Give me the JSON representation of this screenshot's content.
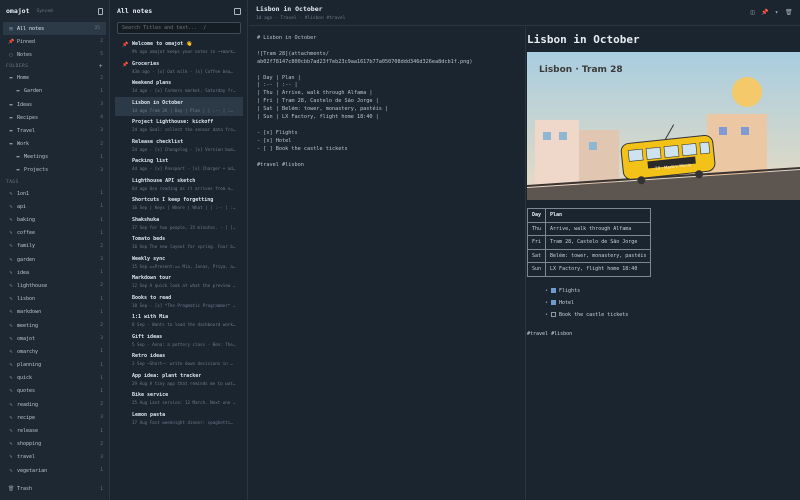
{
  "app": {
    "name": "omajot",
    "sync_status": "Synced"
  },
  "sidebar": {
    "top": [
      {
        "label": "All notes",
        "count": "25",
        "icon": "notes-icon"
      },
      {
        "label": "Pinned",
        "count": "2",
        "icon": "pin-icon"
      },
      {
        "label": "Notes",
        "count": "5",
        "icon": "document-icon"
      }
    ],
    "folders_label": "FOLDERS",
    "folders": [
      {
        "label": "Home",
        "count": "2"
      },
      {
        "label": "Garden",
        "count": "1",
        "indent": true
      },
      {
        "label": "Ideas",
        "count": "3"
      },
      {
        "label": "Recipes",
        "count": "4"
      },
      {
        "label": "Travel",
        "count": "3"
      },
      {
        "label": "Work",
        "count": "2"
      },
      {
        "label": "Meetings",
        "count": "1",
        "indent": true
      },
      {
        "label": "Projects",
        "count": "3",
        "indent": true
      }
    ],
    "tags_label": "TAGS",
    "tags": [
      {
        "label": "1on1",
        "count": "1"
      },
      {
        "label": "api",
        "count": "1"
      },
      {
        "label": "baking",
        "count": "1"
      },
      {
        "label": "coffee",
        "count": "1"
      },
      {
        "label": "family",
        "count": "2"
      },
      {
        "label": "garden",
        "count": "3"
      },
      {
        "label": "idea",
        "count": "1"
      },
      {
        "label": "lighthouse",
        "count": "2"
      },
      {
        "label": "lisbon",
        "count": "1"
      },
      {
        "label": "markdown",
        "count": "1"
      },
      {
        "label": "meeting",
        "count": "2"
      },
      {
        "label": "omajot",
        "count": "3"
      },
      {
        "label": "omarchy",
        "count": "1"
      },
      {
        "label": "planning",
        "count": "1"
      },
      {
        "label": "quick",
        "count": "1"
      },
      {
        "label": "quotes",
        "count": "1"
      },
      {
        "label": "reading",
        "count": "2"
      },
      {
        "label": "recipe",
        "count": "3"
      },
      {
        "label": "release",
        "count": "1"
      },
      {
        "label": "shopping",
        "count": "2"
      },
      {
        "label": "travel",
        "count": "3"
      },
      {
        "label": "vegetarian",
        "count": "1"
      }
    ],
    "trash": {
      "label": "Trash",
      "count": "1"
    }
  },
  "notelist": {
    "title": "All notes",
    "search_placeholder": "Search Titles and text...  /",
    "notes": [
      {
        "title": "Welcome to omajot 👋",
        "preview": "9h ago  omajot keeps your notes in ~+mark…",
        "pinned": true
      },
      {
        "title": "Groceries",
        "preview": "43m ago  - [x] Oat milk - [x] Coffee bea…",
        "pinned": true
      },
      {
        "title": "Weekend plans",
        "preview": "1d ago  - [x] Farmers market, Saturday fr…"
      },
      {
        "title": "Lisbon in October",
        "preview": "1d ago  Tram 28 | Day | Plan | | :-- | :…",
        "active": true
      },
      {
        "title": "Project Lighthouse: kickoff",
        "preview": "2d ago  Goal: collect the sensor data fro…"
      },
      {
        "title": "Release checklist",
        "preview": "2d ago  - [x] Changelog - [x] Version bum…"
      },
      {
        "title": "Packing list",
        "preview": "4d ago  - [x] Passport - [x] Charger + ad…"
      },
      {
        "title": "Lighthouse API sketch",
        "preview": "6d ago  Use reading as it arrives from e…"
      },
      {
        "title": "Shortcuts I keep forgetting",
        "preview": "16 Sep  | Keys | Where | What | | :-- | :…"
      },
      {
        "title": "Shakshuka",
        "preview": "17 Sep  for two people, 25 minutes. - [ ]…"
      },
      {
        "title": "Tomato beds",
        "preview": "16 Sep  The new layout for spring. Four b…"
      },
      {
        "title": "Weekly sync",
        "preview": "15 Sep  ==Present:== Mia, Jonas, Priya, a…"
      },
      {
        "title": "Markdown tour",
        "preview": "12 Sep  A quick look at what the preview …"
      },
      {
        "title": "Books to read",
        "preview": "10 Sep  - [x] *The Pragmatic Programmer* …"
      },
      {
        "title": "1:1 with Mia",
        "preview": "8 Sep  - Wants to lead the dashboard work…"
      },
      {
        "title": "Gift ideas",
        "preview": "5 Sep  - Anna: a pottery class - Ben: The…"
      },
      {
        "title": "Retro ideas",
        "preview": "3 Sep  ~Short~: write down decisions in …"
      },
      {
        "title": "App idea: plant tracker",
        "preview": "29 Aug  A tiny app that reminds me to wat…"
      },
      {
        "title": "Bike service",
        "preview": "25 Aug  Last service: 12 March. Next one …"
      },
      {
        "title": "Lemon pasta",
        "preview": "17 Aug  Fast weeknight dinner: spaghetti…"
      }
    ]
  },
  "note": {
    "title": "Lisbon in October",
    "meta": "1d ago  ·  Travel  ·  #lisbon #travel",
    "source": "# Lisbon in October\n\n![Tram 28](attachments/\nab02f78147c800cbb7ad23f7eb23c9aa1617b77a050708ddd346d326ea8dcb1f.png)\n\n| Day | Plan |\n| :-- | :-- |\n| Thu | Arrive, walk through Alfama |\n| Fri | Tram 28, Castelo de São Jorge |\n| Sat | Belém: tower, monastery, pastéis |\n| Sun | LX Factory, flight home 18:40 |\n\n- [x] Flights\n- [x] Hotel\n- [ ] Book the castle tickets\n\n#travel #lisbon",
    "preview": {
      "title": "Lisbon in October",
      "image_caption": "Lisbon · Tram 28",
      "tram_sign": "28 · Martim Moniz",
      "table_head": [
        "Day",
        "Plan"
      ],
      "table_rows": [
        [
          "Thu",
          "Arrive, walk through Alfama"
        ],
        [
          "Fri",
          "Tram 28, Castelo de São Jorge"
        ],
        [
          "Sat",
          "Belém: tower, monastery, pastéis"
        ],
        [
          "Sun",
          "LX Factory, flight home 18:40"
        ]
      ],
      "tasks": [
        {
          "label": "Flights",
          "done": true
        },
        {
          "label": "Hotel",
          "done": true
        },
        {
          "label": "Book the castle tickets",
          "done": false
        }
      ],
      "tags": "#travel #lisbon"
    }
  }
}
